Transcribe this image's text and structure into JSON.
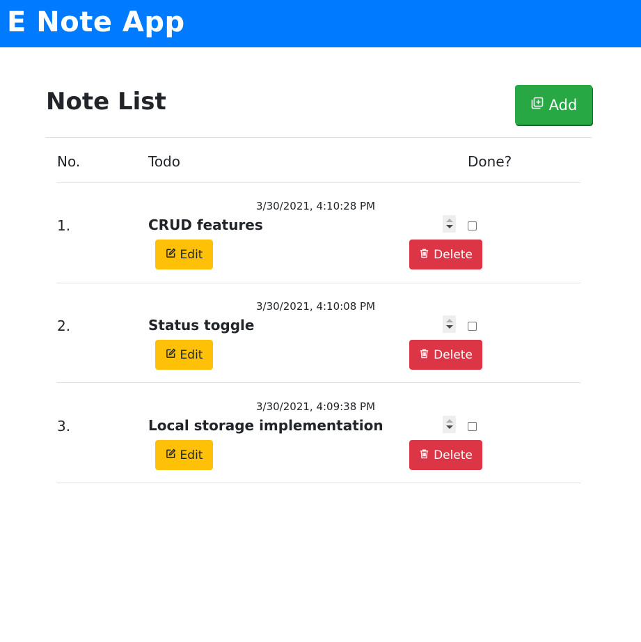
{
  "app": {
    "brand": "E Note App"
  },
  "page": {
    "title": "Note List",
    "add_label": "Add"
  },
  "table": {
    "headers": {
      "no": "No.",
      "todo": "Todo",
      "done": "Done?"
    },
    "rows": [
      {
        "number": "1.",
        "timestamp": "3/30/2021, 4:10:28 PM",
        "todo": "CRUD features",
        "done": false,
        "edit_label": "Edit",
        "delete_label": "Delete"
      },
      {
        "number": "2.",
        "timestamp": "3/30/2021, 4:10:08 PM",
        "todo": "Status toggle",
        "done": false,
        "edit_label": "Edit",
        "delete_label": "Delete"
      },
      {
        "number": "3.",
        "timestamp": "3/30/2021, 4:09:38 PM",
        "todo": "Local storage implementation",
        "done": false,
        "edit_label": "Edit",
        "delete_label": "Delete"
      }
    ]
  },
  "icons": {
    "add": "add-note-icon",
    "edit": "pencil-square-icon",
    "delete": "trash-icon"
  },
  "colors": {
    "navbar": "#007bff",
    "add_button": "#28a745",
    "edit_button": "#ffc107",
    "delete_button": "#dc3545"
  }
}
